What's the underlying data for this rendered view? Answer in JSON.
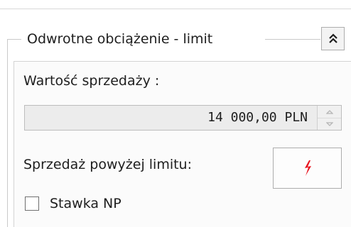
{
  "group": {
    "title": "Odwrotne obciążenie - limit",
    "collapse_icon": "double-chevron-up-icon"
  },
  "sales_value": {
    "label": "Wartość sprzedaży :",
    "value": "14 000,00 PLN"
  },
  "over_limit": {
    "label": "Sprzedaż powyżej limitu:",
    "button_icon": "red-lightning-icon",
    "icon_color": "#e8141e"
  },
  "np_rate": {
    "label": "Stawka NP",
    "checked": false
  }
}
